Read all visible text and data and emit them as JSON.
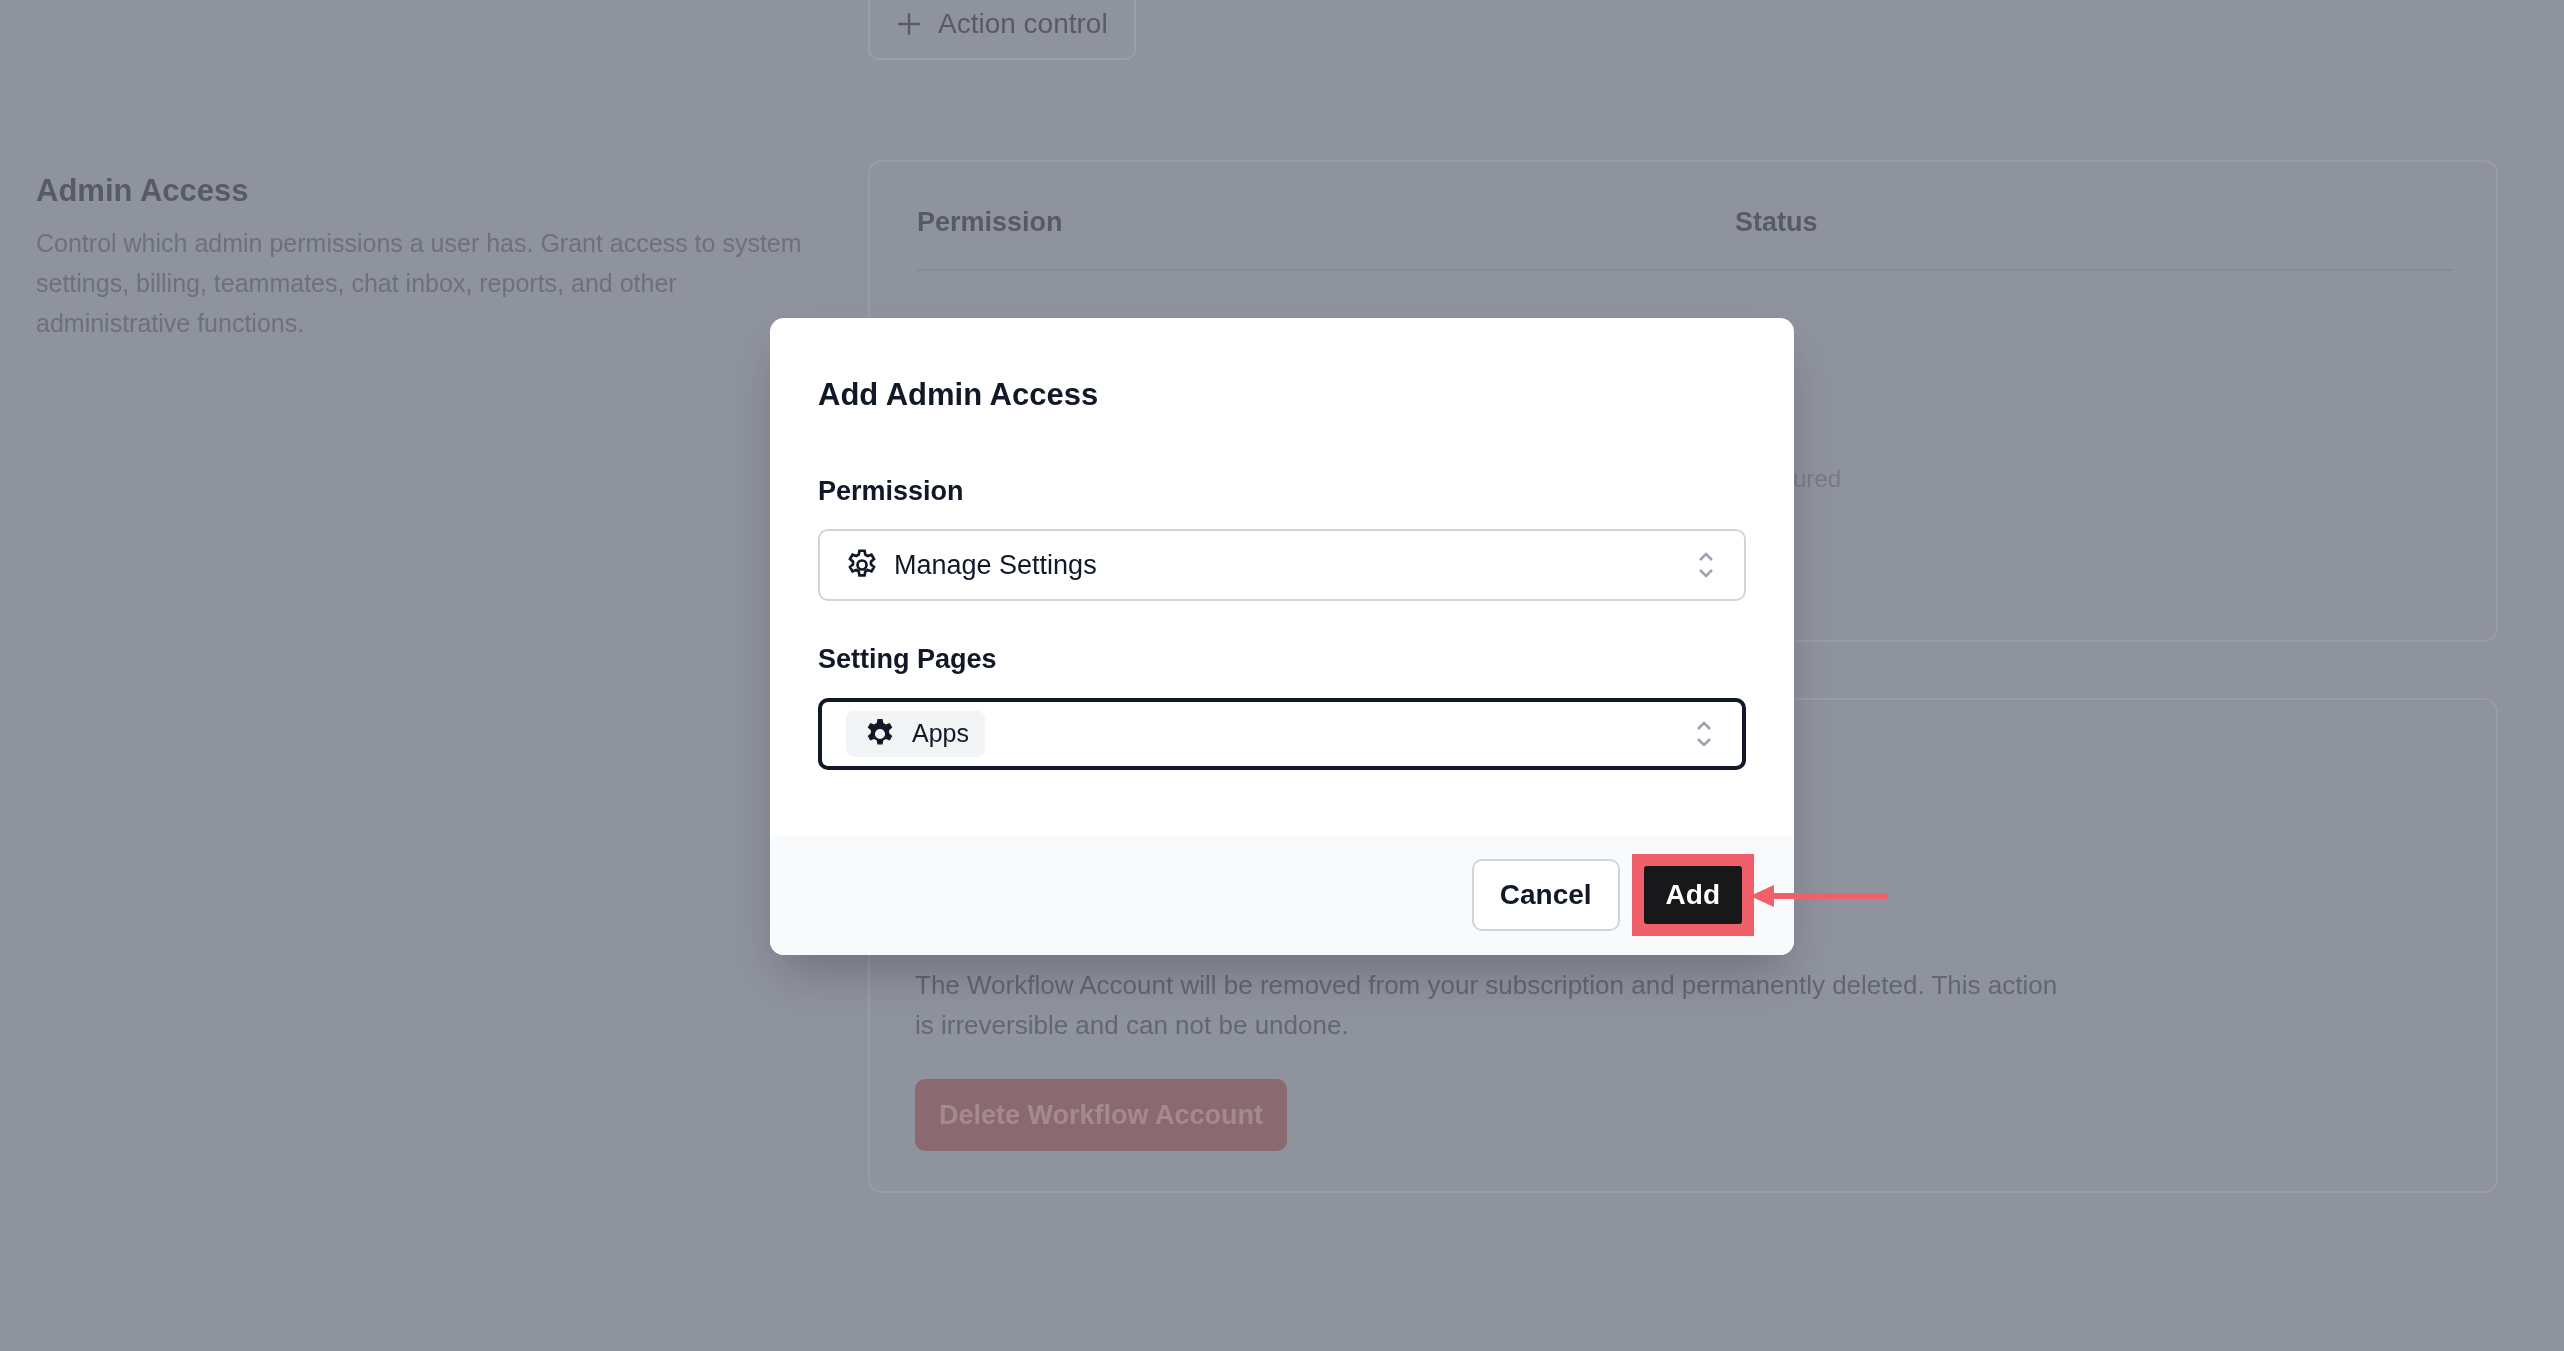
{
  "background": {
    "action_button": {
      "label": "Action control"
    },
    "section": {
      "title": "Admin Access",
      "description": "Control which admin permissions a user has. Grant access to system settings, billing, teammates, chat inbox, reports, and other administrative functions."
    },
    "table": {
      "columns": [
        "Permission",
        "Status"
      ],
      "partial_cell": "ured"
    },
    "danger": {
      "description": "The Workflow Account will be removed from your subscription and permanently deleted. This action is irreversible and can not be undone.",
      "button": "Delete Workflow Account"
    }
  },
  "modal": {
    "title": "Add Admin Access",
    "fields": [
      {
        "label": "Permission",
        "kind": "select",
        "value": "Manage Settings",
        "focused": false
      },
      {
        "label": "Setting Pages",
        "kind": "tags",
        "tags": [
          "Apps"
        ],
        "focused": true
      }
    ],
    "buttons": [
      {
        "label": "Cancel",
        "kind": "secondary",
        "highlighted": false
      },
      {
        "label": "Add",
        "kind": "primary",
        "highlighted": true
      }
    ]
  }
}
